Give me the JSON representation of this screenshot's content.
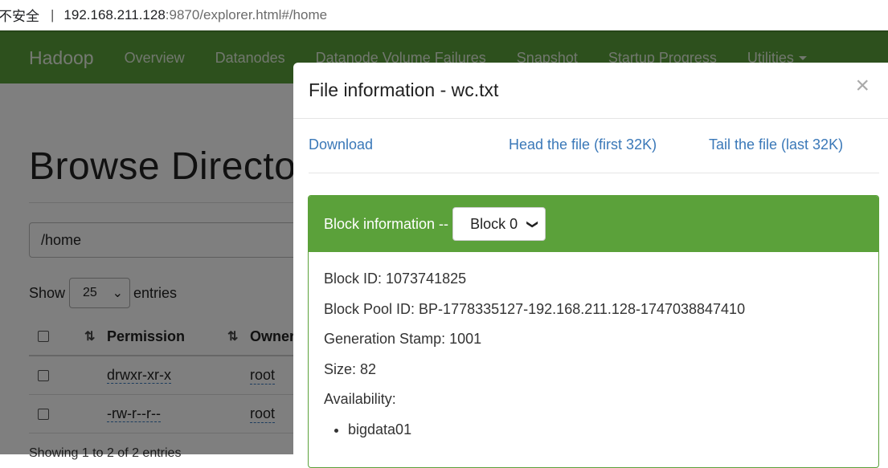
{
  "browser": {
    "security_label": "不安全",
    "separator": "|",
    "url_host": "192.168.211.128",
    "url_rest": ":9870/explorer.html#/home"
  },
  "navbar": {
    "brand": "Hadoop",
    "items": [
      "Overview",
      "Datanodes",
      "Datanode Volume Failures",
      "Snapshot",
      "Startup Progress",
      "Utilities"
    ]
  },
  "page": {
    "title": "Browse Directory",
    "path_value": "/home",
    "show_label": "Show",
    "entries_value": "25",
    "entries_label": "entries",
    "columns": [
      "Permission",
      "Owner"
    ],
    "rows": [
      {
        "permission": "drwxr-xr-x",
        "owner": "root"
      },
      {
        "permission": "-rw-r--r--",
        "owner": "root"
      }
    ],
    "footer": "Showing 1 to 2 of 2 entries"
  },
  "modal": {
    "title": "File information - wc.txt",
    "close_glyph": "×",
    "links": {
      "download": "Download",
      "head": "Head the file (first 32K)",
      "tail": "Tail the file (last 32K)"
    },
    "block": {
      "heading": "Block information --",
      "selected": "Block 0",
      "block_id": "Block ID: 1073741825",
      "block_pool_id": "Block Pool ID: BP-1778335127-192.168.211.128-1747038847410",
      "generation_stamp": "Generation Stamp: 1001",
      "size": "Size: 82",
      "availability_label": "Availability:",
      "availability": [
        "bigdata01"
      ]
    }
  },
  "colors": {
    "navbar": "#5ba13a",
    "link": "#3a78b8",
    "overlay": "rgba(0,0,0,0.5)"
  }
}
